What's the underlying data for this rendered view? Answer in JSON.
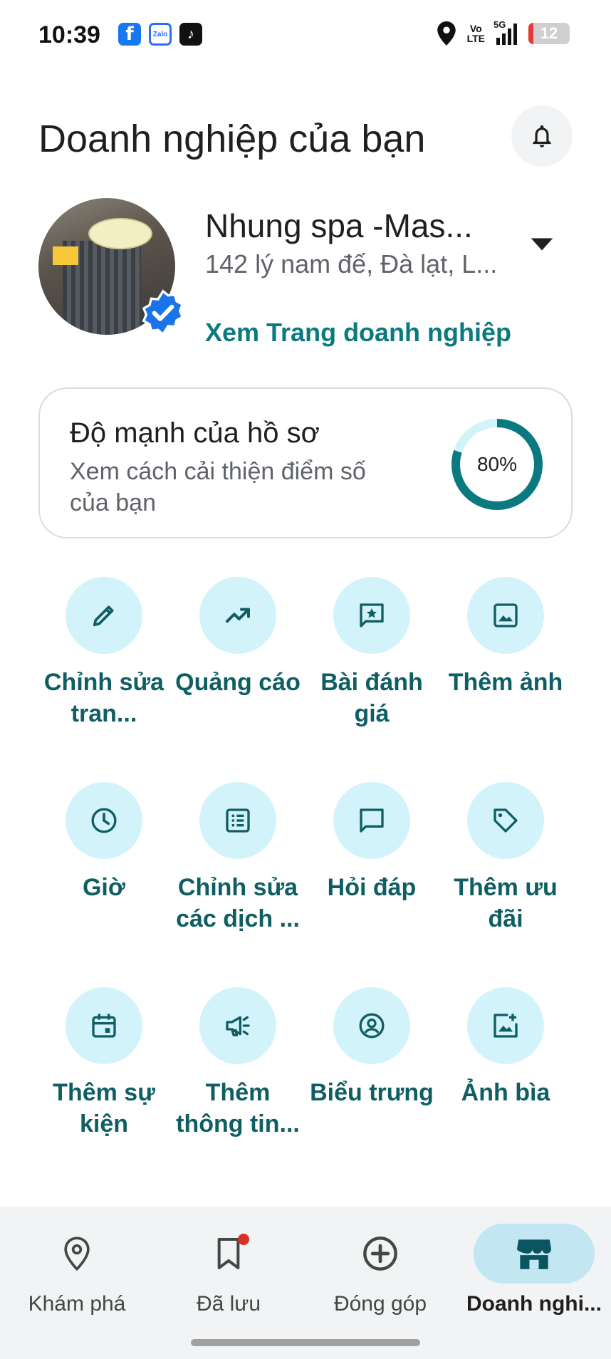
{
  "status_bar": {
    "time": "10:39",
    "apps": [
      {
        "name": "facebook-icon",
        "glyph": "f"
      },
      {
        "name": "zalo-icon",
        "glyph": "Zalo"
      },
      {
        "name": "tiktok-icon",
        "glyph": "♪"
      }
    ],
    "network_volte": "Vo\nLTE",
    "network_type": "5G",
    "battery_level": "12",
    "battery_fraction": 0.12
  },
  "header": {
    "title": "Doanh nghiệp của bạn",
    "bell_icon": "notification-bell-icon"
  },
  "business": {
    "name": "Nhung spa -Mas...",
    "address": "142 lý nam đế, Đà lạt, L...",
    "view_link": "Xem Trang doanh nghiệp",
    "verified_icon": "verified-badge-icon"
  },
  "profile_strength": {
    "title": "Độ mạnh của hồ sơ",
    "subtitle": "Xem cách cải thiện điểm số của bạn",
    "percent_label": "80%",
    "value": 0.8
  },
  "actions": [
    {
      "label": "Chỉnh sửa tran...",
      "icon": "edit-pencil-icon"
    },
    {
      "label": "Quảng cáo",
      "icon": "trending-up-icon"
    },
    {
      "label": "Bài đánh giá",
      "icon": "review-star-icon"
    },
    {
      "label": "Thêm ảnh",
      "icon": "add-photo-icon"
    },
    {
      "label": "Giờ",
      "icon": "clock-icon"
    },
    {
      "label": "Chỉnh sửa các dịch ...",
      "icon": "services-list-icon"
    },
    {
      "label": "Hỏi đáp",
      "icon": "chat-bubble-icon"
    },
    {
      "label": "Thêm ưu đãi",
      "icon": "offer-tag-icon"
    },
    {
      "label": "Thêm sự kiện",
      "icon": "calendar-event-icon"
    },
    {
      "label": "Thêm thông tin...",
      "icon": "megaphone-icon"
    },
    {
      "label": "Biểu trưng",
      "icon": "logo-account-icon"
    },
    {
      "label": "Ảnh bìa",
      "icon": "cover-photo-icon"
    }
  ],
  "bottom_nav": [
    {
      "label": "Khám phá",
      "icon": "explore-pin-icon",
      "active": false
    },
    {
      "label": "Đã lưu",
      "icon": "bookmark-icon",
      "active": false,
      "badge": true
    },
    {
      "label": "Đóng góp",
      "icon": "add-circle-icon",
      "active": false
    },
    {
      "label": "Doanh nghi...",
      "icon": "storefront-icon",
      "active": true
    }
  ],
  "colors": {
    "accent_teal": "#0b7a80",
    "action_label": "#0f5e63",
    "action_circle": "#d3f3fb",
    "ring_track": "#d3f3fb",
    "ring_progress": "#0b7a80",
    "verified_blue": "#1a73e8",
    "nav_active_bg": "#c2e7f2",
    "nav_active_icon": "#0b5560"
  }
}
